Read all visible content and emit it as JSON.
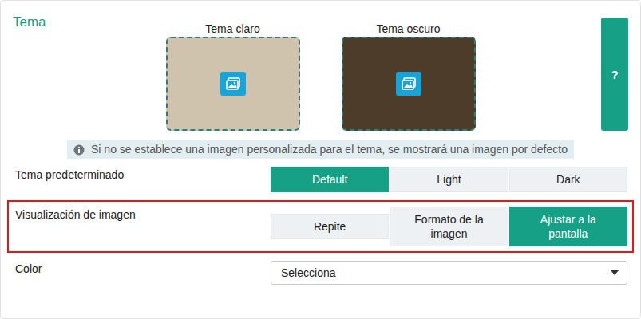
{
  "panel": {
    "title": "Tema",
    "help": "?"
  },
  "previews": [
    {
      "label": "Tema claro",
      "color": "#cfc3ad"
    },
    {
      "label": "Tema oscuro",
      "color": "#4e3c2b"
    }
  ],
  "info": "Si no se establece una imagen personalizada para el tema, se mostrará una imagen por defecto",
  "fields": [
    {
      "label": "Tema predeterminado",
      "kind": "segmented",
      "highlighted": false,
      "options": [
        {
          "label": "Default",
          "selected": true
        },
        {
          "label": "Light",
          "selected": false
        },
        {
          "label": "Dark",
          "selected": false
        }
      ]
    },
    {
      "label": "Visualización de imagen",
      "kind": "segmented",
      "highlighted": true,
      "options": [
        {
          "label": "Repite",
          "selected": false
        },
        {
          "label": "Formato de la imagen",
          "selected": false
        },
        {
          "label": "Ajustar a la pantalla",
          "selected": true
        }
      ]
    },
    {
      "label": "Color",
      "kind": "select",
      "highlighted": false,
      "value": "Selecciona"
    }
  ]
}
